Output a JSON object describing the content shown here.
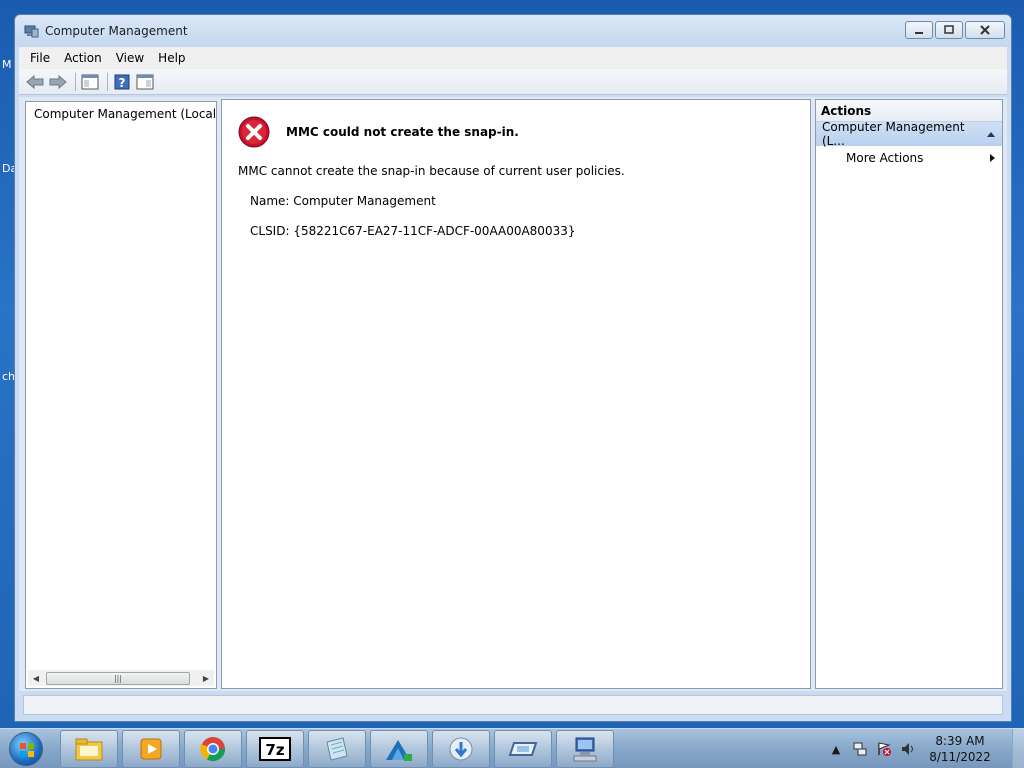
{
  "window": {
    "title": "Computer Management",
    "buttons": [
      "minimize",
      "maximize",
      "close"
    ]
  },
  "menu": [
    "File",
    "Action",
    "View",
    "Help"
  ],
  "tree": {
    "root_label": "Computer Management (Local"
  },
  "error": {
    "title": "MMC could not create the snap-in.",
    "message": "MMC cannot create the snap-in because of current user policies.",
    "name": "Name: Computer Management",
    "clsid": "CLSID: {58221C67-EA27-11CF-ADCF-00AA00A80033}"
  },
  "actions": {
    "header": "Actions",
    "group": "Computer Management (L...",
    "more": "More Actions"
  },
  "desktop_labels": [
    "M",
    "Da",
    "ch"
  ],
  "taskbar": {
    "apps": [
      "explorer-icon",
      "media-player-icon",
      "chrome-icon",
      "7zip-icon",
      "notepad-icon",
      "wireshark-icon",
      "update-icon",
      "network-icon",
      "computer-management-icon"
    ],
    "time": "8:39 AM",
    "date": "8/11/2022"
  },
  "colors": {
    "accent": "#2a73c6",
    "error_red": "#c8102e",
    "selected_group": "#c3d7ef"
  }
}
